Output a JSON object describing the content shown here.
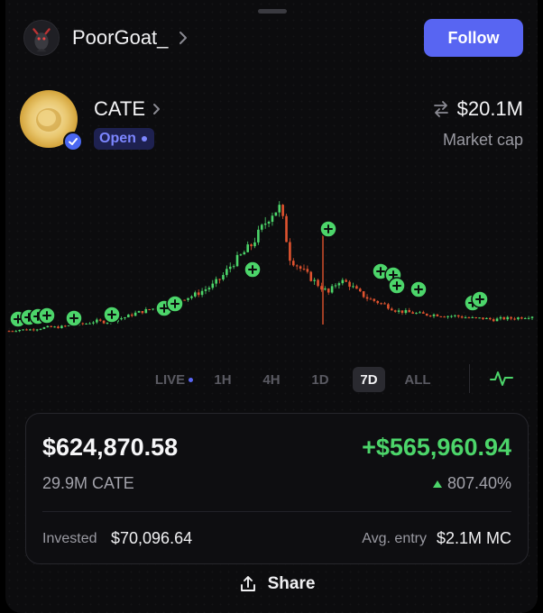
{
  "profile": {
    "username": "PoorGoat_",
    "follow_label": "Follow"
  },
  "token": {
    "name": "CATE",
    "status": "Open",
    "market_cap": "$20.1M",
    "market_cap_label": "Market cap"
  },
  "timeframes": {
    "items": [
      "LIVE",
      "1H",
      "4H",
      "1D",
      "7D",
      "ALL"
    ],
    "selected": "7D"
  },
  "position": {
    "value": "$624,870.58",
    "pnl": "+$565,960.94",
    "amount": "29.9M CATE",
    "pnl_percent": "807.40%",
    "invested_label": "Invested",
    "invested": "$70,096.64",
    "avg_entry_label": "Avg. entry",
    "avg_entry": "$2.1M MC"
  },
  "share_label": "Share",
  "colors": {
    "accent": "#5865f2",
    "positive": "#4cd56a",
    "negative": "#e0532f"
  },
  "icons": {
    "avatar": "goat-avatar-icon",
    "chevron": "chevron-right-icon",
    "verified": "check-badge-icon",
    "swap": "swap-arrows-icon",
    "buy_marker": "plus-circle-icon",
    "chart_toggle": "pulse-line-icon",
    "share": "share-upload-icon"
  },
  "chart_data": {
    "type": "candlestick",
    "period": "7D",
    "relative_series": [
      0.02,
      0.03,
      0.03,
      0.04,
      0.05,
      0.05,
      0.06,
      0.07,
      0.08,
      0.1,
      0.09,
      0.11,
      0.13,
      0.16,
      0.18,
      0.2,
      0.22,
      0.25,
      0.28,
      0.3,
      0.34,
      0.38,
      0.45,
      0.55,
      0.62,
      0.7,
      0.82,
      0.95,
      1.0,
      0.6,
      0.52,
      0.45,
      0.38,
      0.32,
      0.42,
      0.4,
      0.33,
      0.28,
      0.25,
      0.22,
      0.18,
      0.17,
      0.16,
      0.15,
      0.15,
      0.14,
      0.14,
      0.13,
      0.12,
      0.12,
      0.11,
      0.12,
      0.12,
      0.13,
      0.14
    ],
    "buy_markers": 15
  }
}
